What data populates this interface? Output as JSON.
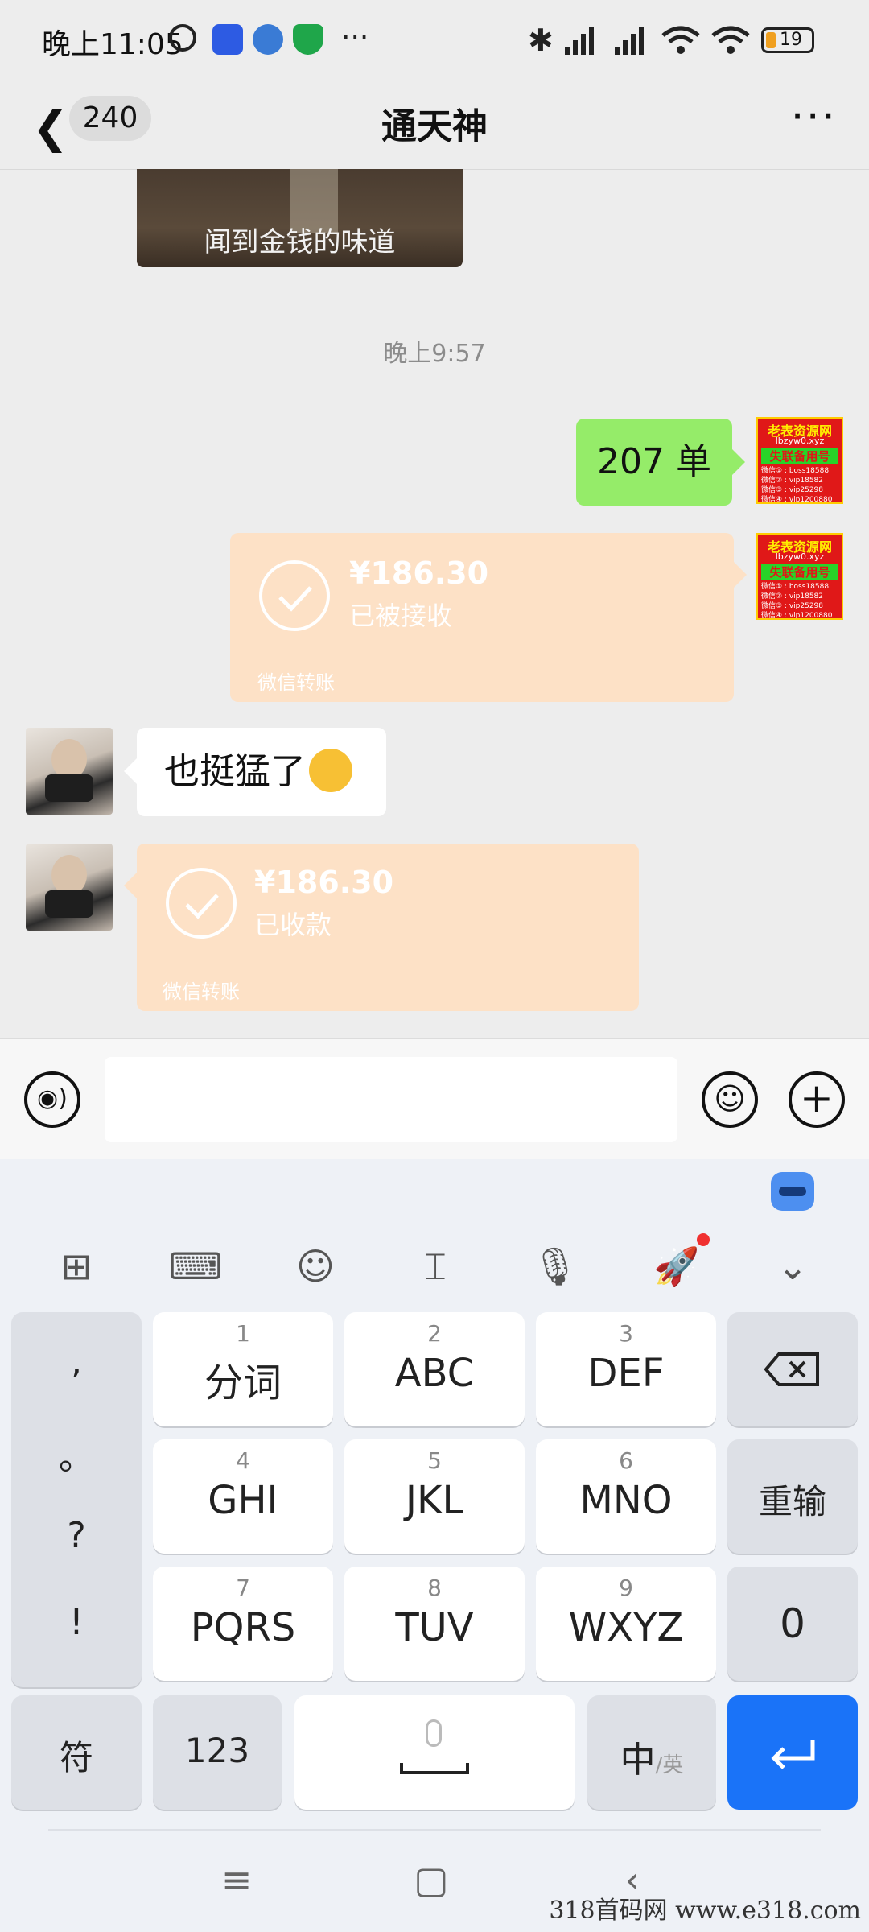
{
  "status_bar": {
    "time": "晚上11:05",
    "more": "···",
    "battery": "19"
  },
  "header": {
    "back_count": "240",
    "title": "通天神",
    "more": "···"
  },
  "chat": {
    "image_caption": "闻到金钱的味道",
    "timestamp": "晚上9:57",
    "messages": {
      "sent_text": "207 单",
      "sent_transfer": {
        "amount": "¥186.30",
        "status": "已被接收",
        "footer": "微信转账"
      },
      "recv_text": "也挺猛了",
      "recv_transfer": {
        "amount": "¥186.30",
        "status": "已收款",
        "footer": "微信转账"
      }
    },
    "ad_avatar": {
      "title": "老表资源网",
      "site": "lbzyw0.xyz",
      "subtitle": "失联备用号",
      "lines": [
        "微信① : boss18588",
        "微信② : vip18582",
        "微信③ : vip25298",
        "微信④ : vip1200880"
      ]
    }
  },
  "input_bar": {
    "placeholder": ""
  },
  "keyboard": {
    "toolbar_icons": [
      "grid-icon",
      "keyboard-icon",
      "smiley-icon",
      "text-cursor-icon",
      "microphone-icon",
      "rocket-icon",
      "chevron-down-icon"
    ],
    "symbols": [
      ",",
      "。",
      "?",
      "!"
    ],
    "keys": [
      {
        "num": "1",
        "label": "分词"
      },
      {
        "num": "2",
        "label": "ABC"
      },
      {
        "num": "3",
        "label": "DEF"
      },
      {
        "num": "4",
        "label": "GHI"
      },
      {
        "num": "5",
        "label": "JKL"
      },
      {
        "num": "6",
        "label": "MNO"
      },
      {
        "num": "7",
        "label": "PQRS"
      },
      {
        "num": "8",
        "label": "TUV"
      },
      {
        "num": "9",
        "label": "WXYZ"
      }
    ],
    "reinput": "重输",
    "zero": "0",
    "fu": "符",
    "num123": "123",
    "zh": "中",
    "en": "/英"
  },
  "watermark": "318首码网  www.e318.com",
  "colors": {
    "green_bubble": "#95ec69",
    "transfer": "#fde1c6",
    "enter": "#1a73f8"
  }
}
